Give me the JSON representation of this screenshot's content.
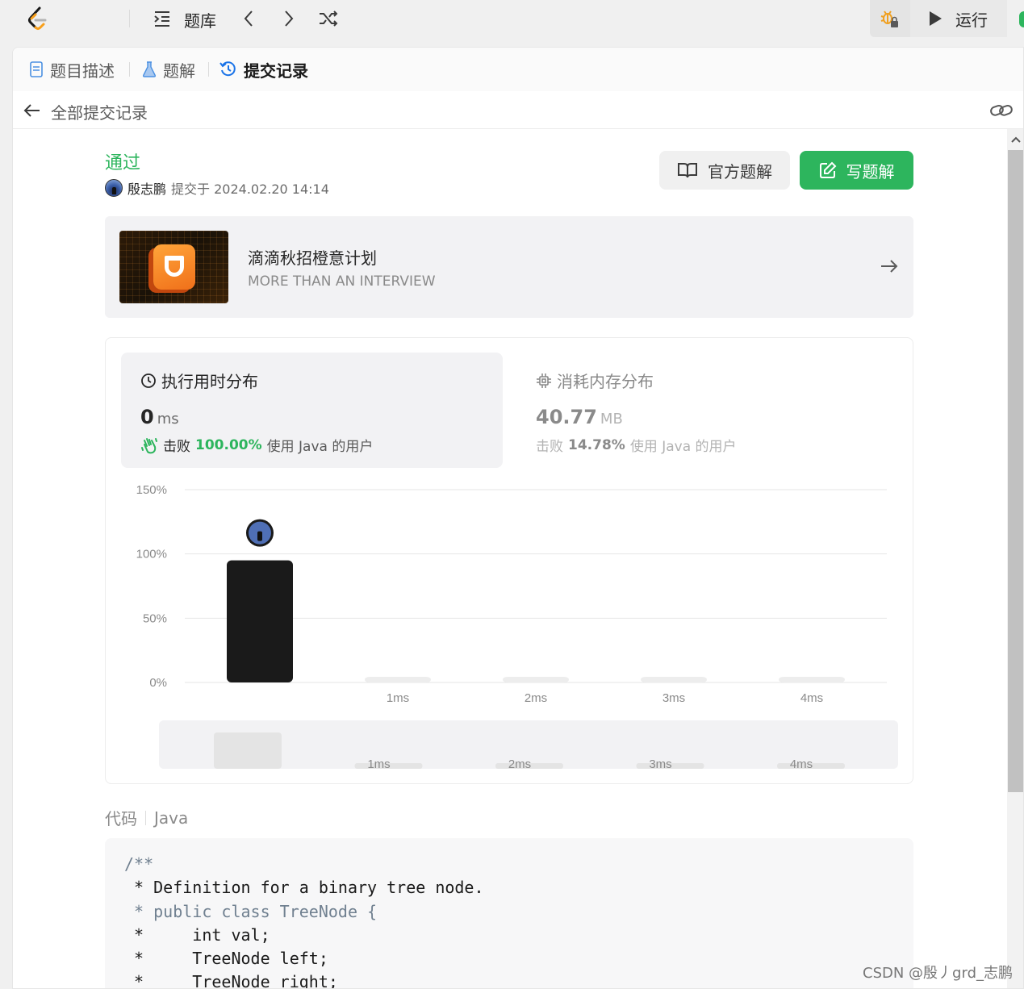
{
  "topbar": {
    "problem_bank_label": "题库",
    "run_label": "运行"
  },
  "tabs": [
    {
      "label": "题目描述"
    },
    {
      "label": "题解"
    },
    {
      "label": "提交记录"
    }
  ],
  "subhead": {
    "title": "全部提交记录"
  },
  "submission": {
    "status": "通过",
    "author": "殷志鹏",
    "submitted_text": "提交于 2024.02.20 14:14"
  },
  "actions": {
    "official_solution": "官方题解",
    "write_solution": "写题解"
  },
  "banner": {
    "title": "滴滴秋招橙意计划",
    "subtitle": "MORE THAN AN INTERVIEW"
  },
  "runtime": {
    "title": "执行用时分布",
    "value": "0",
    "unit": "ms",
    "beat_prefix": "击败",
    "beat_pct": "100.00%",
    "beat_suffix": "使用 Java 的用户"
  },
  "memory": {
    "title": "消耗内存分布",
    "value": "40.77",
    "unit": "MB",
    "beat_prefix": "击败",
    "beat_pct": "14.78%",
    "beat_suffix": "使用 Java 的用户"
  },
  "chart_data": {
    "type": "bar",
    "categories": [
      "",
      "1ms",
      "2ms",
      "3ms",
      "4ms"
    ],
    "values": [
      95,
      1,
      1,
      1,
      1
    ],
    "y_ticks": [
      "150%",
      "100%",
      "50%",
      "0%"
    ],
    "ylim": [
      0,
      150
    ],
    "grid": true,
    "highlight_index": 0,
    "colors": {
      "highlight": "#1a1a1a",
      "normal": "#ededed",
      "grid": "#e6e6e6"
    },
    "overview": {
      "categories": [
        "",
        "1ms",
        "2ms",
        "3ms",
        "4ms"
      ]
    }
  },
  "code": {
    "label": "代码",
    "language": "Java",
    "lines": [
      {
        "text": "/**",
        "kind": "comment"
      },
      {
        "text": " * Definition for a binary tree node.",
        "kind": "plain"
      },
      {
        "text": " * public class TreeNode {",
        "kind": "comment"
      },
      {
        "text": " *     int val;",
        "kind": "plain"
      },
      {
        "text": " *     TreeNode left;",
        "kind": "plain"
      },
      {
        "text": " *     TreeNode right;",
        "kind": "plain"
      }
    ]
  },
  "watermark": "CSDN @殷丿grd_志鹏",
  "colors": {
    "accent": "#2db55d",
    "blue": "#1a73e8"
  }
}
